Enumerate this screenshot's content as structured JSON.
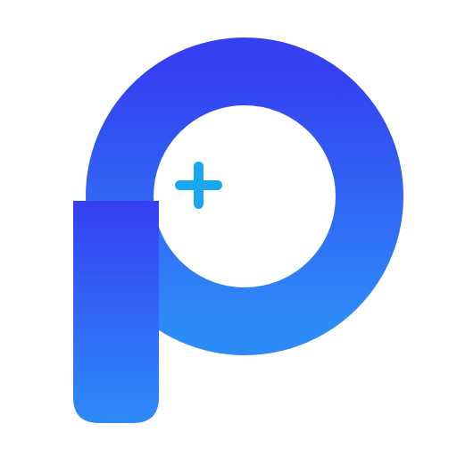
{
  "logo": {
    "icon": "letter-p-plus-logo",
    "colors": {
      "gradient_top": "#3540F2",
      "gradient_bottom": "#2D8BF7",
      "plus": "#1AA7F0",
      "background": "#FFFFFF"
    }
  }
}
